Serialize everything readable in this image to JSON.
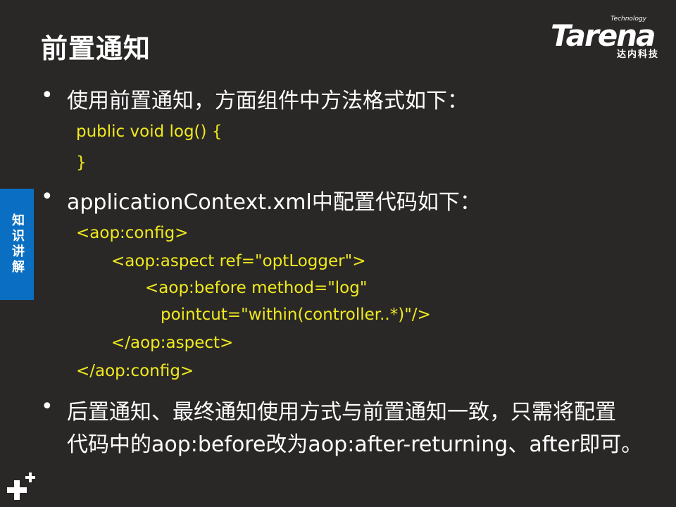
{
  "slide": {
    "title": "前置通知",
    "logo": {
      "small": "Technology",
      "word": "Tarena",
      "chinese": "达内科技"
    },
    "side_tab": "知识讲解",
    "bullets": [
      {
        "text": "使用前置通知，方面组件中方法格式如下："
      },
      {
        "text": "applicationContext.xml中配置代码如下："
      },
      {
        "line1": "后置通知、最终通知使用方式与前置通知一致，只需将配置",
        "line2": "代码中的aop:before改为aop:after-returning、after即可。"
      }
    ],
    "code1": [
      "public void log() {",
      "}"
    ],
    "code2": [
      "<aop:config>",
      "<aop:aspect ref=\"optLogger\">",
      "<aop:before method=\"log\"",
      "pointcut=\"within(controller..*)\"/>",
      "</aop:aspect>",
      "</aop:config>"
    ],
    "colors": {
      "background": "#2a2827",
      "code": "#f0ea1e",
      "tab": "#0a6fc2"
    },
    "icons": {
      "corner": "plus-icon"
    }
  }
}
